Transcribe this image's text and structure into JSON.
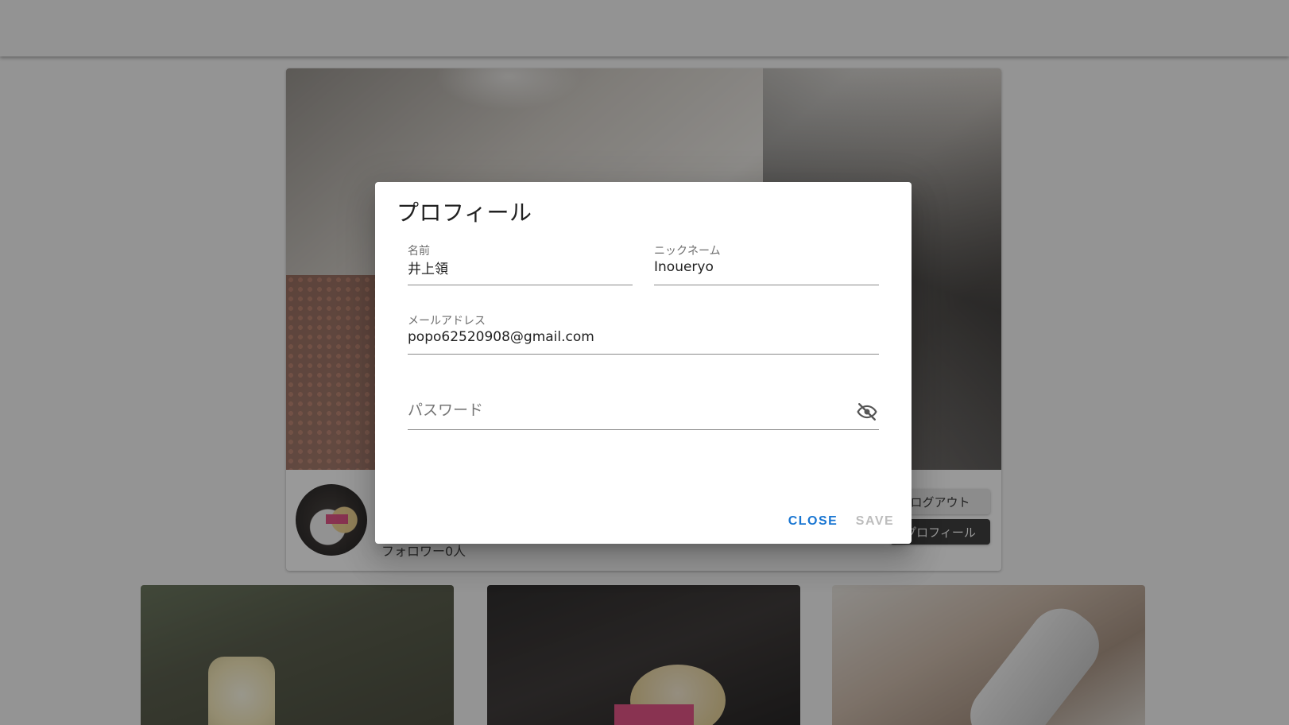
{
  "background": {
    "followers_text": "フォロワー0人",
    "logout_label": "ログアウト",
    "profile_label": "プロフィール"
  },
  "dialog": {
    "title": "プロフィール",
    "fields": {
      "name": {
        "label": "名前",
        "value": "井上領"
      },
      "nickname": {
        "label": "ニックネーム",
        "value": "Inoueryo"
      },
      "email": {
        "label": "メールアドレス",
        "value": "popo62520908@gmail.com"
      },
      "password": {
        "placeholder": "パスワード",
        "visibility_icon": "eye-off-icon"
      }
    },
    "actions": {
      "close_label": "CLOSE",
      "save_label": "SAVE"
    }
  },
  "colors": {
    "primary": "#1976d2",
    "disabled": "#bdbdbd",
    "scrim": "rgba(33,33,33,0.46)"
  }
}
